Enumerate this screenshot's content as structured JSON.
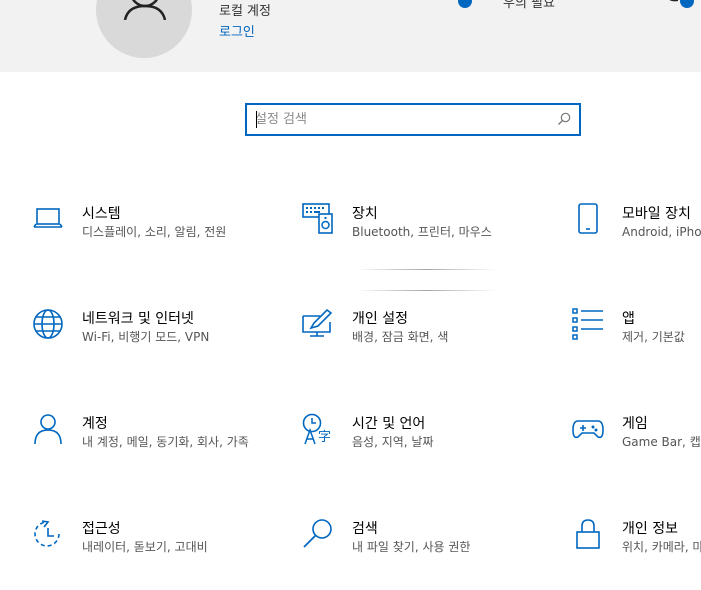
{
  "header": {
    "account_type": "로컬 계정",
    "login_link": "로그인",
    "status_text": "우의 필요"
  },
  "search": {
    "placeholder": "설정 검색",
    "value": ""
  },
  "accent_color": "#0067c0",
  "tiles": [
    {
      "title": "시스템",
      "subtitle": "디스플레이, 소리, 알림, 전원",
      "icon": "laptop-icon"
    },
    {
      "title": "장치",
      "subtitle": "Bluetooth, 프린터, 마우스",
      "icon": "devices-icon"
    },
    {
      "title": "모바일 장치",
      "subtitle": "Android, iPhon",
      "icon": "phone-icon"
    },
    {
      "title": "네트워크 및 인터넷",
      "subtitle": "Wi-Fi, 비행기 모드, VPN",
      "icon": "globe-icon"
    },
    {
      "title": "개인 설정",
      "subtitle": "배경, 잠금 화면, 색",
      "icon": "personalize-icon"
    },
    {
      "title": "앱",
      "subtitle": "제거, 기본값",
      "icon": "apps-list-icon"
    },
    {
      "title": "계정",
      "subtitle": "내 계정, 메일, 동기화, 회사, 가족",
      "icon": "person-icon"
    },
    {
      "title": "시간 및 언어",
      "subtitle": "음성, 지역, 날짜",
      "icon": "time-language-icon"
    },
    {
      "title": "게임",
      "subtitle": "Game Bar, 캡처",
      "icon": "gamepad-icon"
    },
    {
      "title": "접근성",
      "subtitle": "내레이터, 돋보기, 고대비",
      "icon": "accessibility-icon"
    },
    {
      "title": "검색",
      "subtitle": "내 파일 찾기, 사용 권한",
      "icon": "search-magnifier-icon"
    },
    {
      "title": "개인 정보",
      "subtitle": "위치, 카메라, 마",
      "icon": "lock-icon"
    }
  ]
}
